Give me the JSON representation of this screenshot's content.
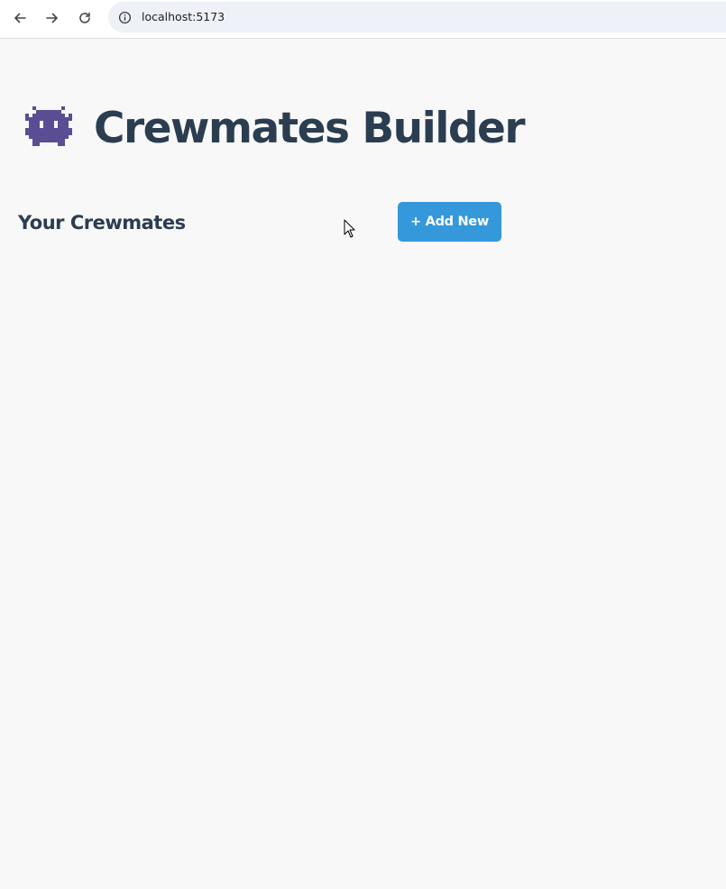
{
  "browser": {
    "url": "localhost:5173",
    "icons": {
      "back": "arrow-left-icon",
      "forward": "arrow-right-icon",
      "reload": "reload-icon",
      "site_info": "info-icon"
    }
  },
  "app": {
    "title": "Crewmates Builder",
    "title_icon": "alien-monster-icon",
    "section_title": "Your Crewmates",
    "add_button_label": "+ Add New"
  },
  "colors": {
    "background": "#f8f8f8",
    "heading": "#2b3d50",
    "accent_button": "#3498db",
    "title_icon": "#5b4d93"
  }
}
